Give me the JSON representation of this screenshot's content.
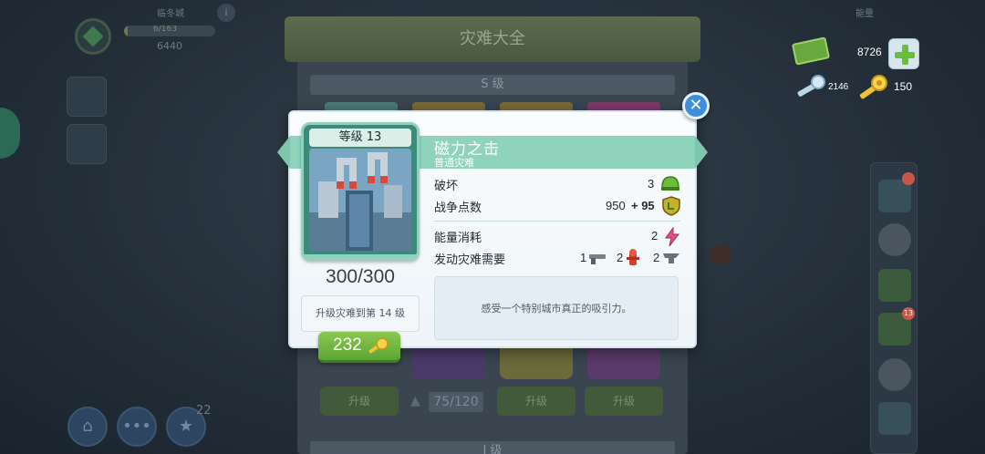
{
  "background": {
    "city_label": "临冬城",
    "xp_text": "6/163",
    "coins_text": "6440",
    "info_glyph": "i",
    "energy_label": "能量",
    "bottom_count": "22",
    "catalog_title": "灾难大全",
    "tier_s": "S 级",
    "tier_next": "I 级",
    "upgrade_label": "升级",
    "progress_text": "75/120",
    "red_badge": "13"
  },
  "currency": {
    "cash": "8726",
    "silver_keys": "2146",
    "gold_keys": "150"
  },
  "popup": {
    "card_level": "等级 13",
    "count_text": "300/300",
    "upgrade_hint": "升级灾难到第 14 级",
    "upgrade_cost": "232",
    "title": "磁力之击",
    "subtitle": "普通灾难",
    "stats": {
      "damage_label": "破坏",
      "damage_value": "3",
      "war_points_label": "战争点数",
      "war_points_base": "950",
      "war_points_bonus": "+ 95",
      "energy_label": "能量消耗",
      "energy_value": "2",
      "requirements_label": "发动灾难需要",
      "req_1": "1",
      "req_2": "2",
      "req_3": "2"
    },
    "description": "感受一个特别城市真正的吸引力。",
    "close_glyph": "✕"
  },
  "icons": [
    "cash-icon",
    "plus-icon",
    "silver-key-icon",
    "gold-key-icon",
    "helmet-icon",
    "shield-icon",
    "lightning-icon",
    "gun-icon",
    "hydrant-icon",
    "anvil-icon",
    "close-icon",
    "key-icon"
  ],
  "colors": {
    "accent_teal": "#8fd3bd",
    "button_green": "#5da534",
    "close_blue": "#3f8ed8"
  }
}
